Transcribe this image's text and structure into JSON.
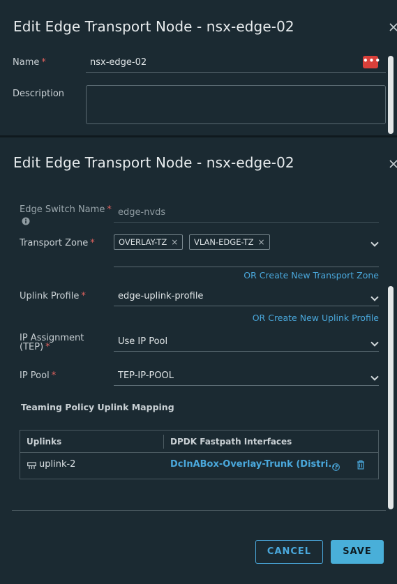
{
  "background_dialog": {
    "title": "Edit Edge Transport Node - nsx-edge-02",
    "close_icon": "close-icon",
    "name_label": "Name",
    "name_value": "nsx-edge-02",
    "description_label": "Description",
    "description_value": ""
  },
  "dialog": {
    "title": "Edit Edge Transport Node - nsx-edge-02",
    "close_icon": "close-icon",
    "edge_switch_name_label": "Edge Switch Name",
    "edge_switch_name_value": "edge-nvds",
    "transport_zone_label": "Transport Zone",
    "transport_zones": [
      "OVERLAY-TZ",
      "VLAN-EDGE-TZ"
    ],
    "create_transport_zone_link": "OR Create New Transport Zone",
    "uplink_profile_label": "Uplink Profile",
    "uplink_profile_value": "edge-uplink-profile",
    "create_uplink_profile_link": "OR Create New Uplink Profile",
    "ip_assignment_label_line1": "IP Assignment",
    "ip_assignment_label_line2": "(TEP)",
    "ip_assignment_value": "Use IP Pool",
    "ip_pool_label": "IP Pool",
    "ip_pool_value": "TEP-IP-POOL",
    "teaming_title": "Teaming Policy Uplink Mapping",
    "table": {
      "columns": [
        "Uplinks",
        "DPDK Fastpath Interfaces"
      ],
      "rows": [
        {
          "uplink": "uplink-2",
          "interface": "DcInABox-Overlay-Trunk (Distri..."
        }
      ]
    },
    "cancel_label": "CANCEL",
    "save_label": "SAVE"
  },
  "colors": {
    "background": "#1b2a32",
    "accent": "#49afd9",
    "required": "#e0625e",
    "danger_button": "#d9403a"
  }
}
